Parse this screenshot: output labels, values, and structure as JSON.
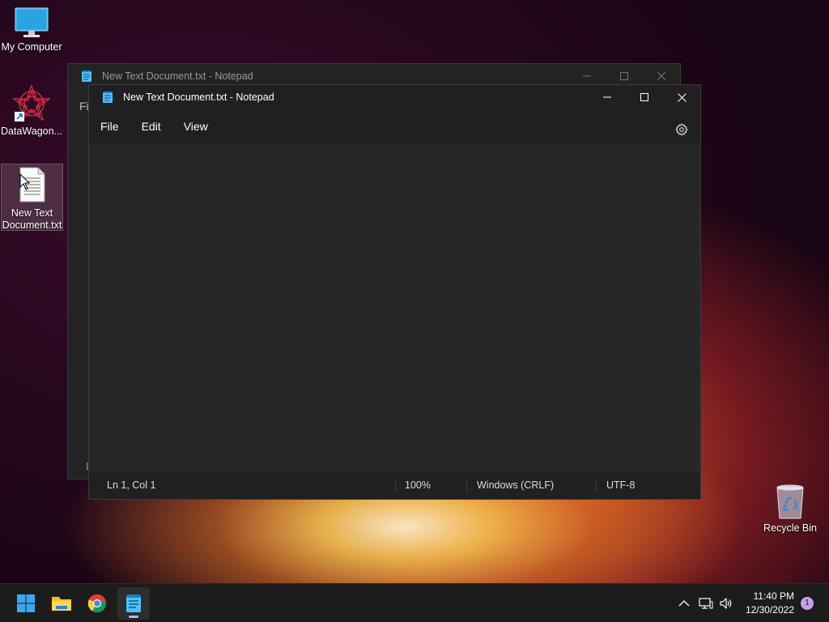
{
  "desktop": {
    "icons": [
      {
        "label": "My Computer",
        "icon": "monitor-icon"
      },
      {
        "label": "DataWagon...",
        "icon": "datawagon-app-icon"
      },
      {
        "label": "New Text Document.txt",
        "icon": "text-file-icon"
      },
      {
        "label": "Recycle Bin",
        "icon": "recycle-bin-icon"
      }
    ]
  },
  "back_window": {
    "title": "New Text Document.txt - Notepad",
    "menu_partial": "Fil",
    "status_partial": "L"
  },
  "front_window": {
    "title": "New Text Document.txt - Notepad",
    "menu": [
      "File",
      "Edit",
      "View"
    ],
    "status": {
      "position": "Ln 1, Col 1",
      "zoom": "100%",
      "line_ending": "Windows (CRLF)",
      "encoding": "UTF-8"
    }
  },
  "taskbar": {
    "time": "11:40 PM",
    "date": "12/30/2022",
    "notification_count": "1"
  },
  "colors": {
    "notepad_icon": "#4cc2ff",
    "accent": "#c9a0e8"
  }
}
